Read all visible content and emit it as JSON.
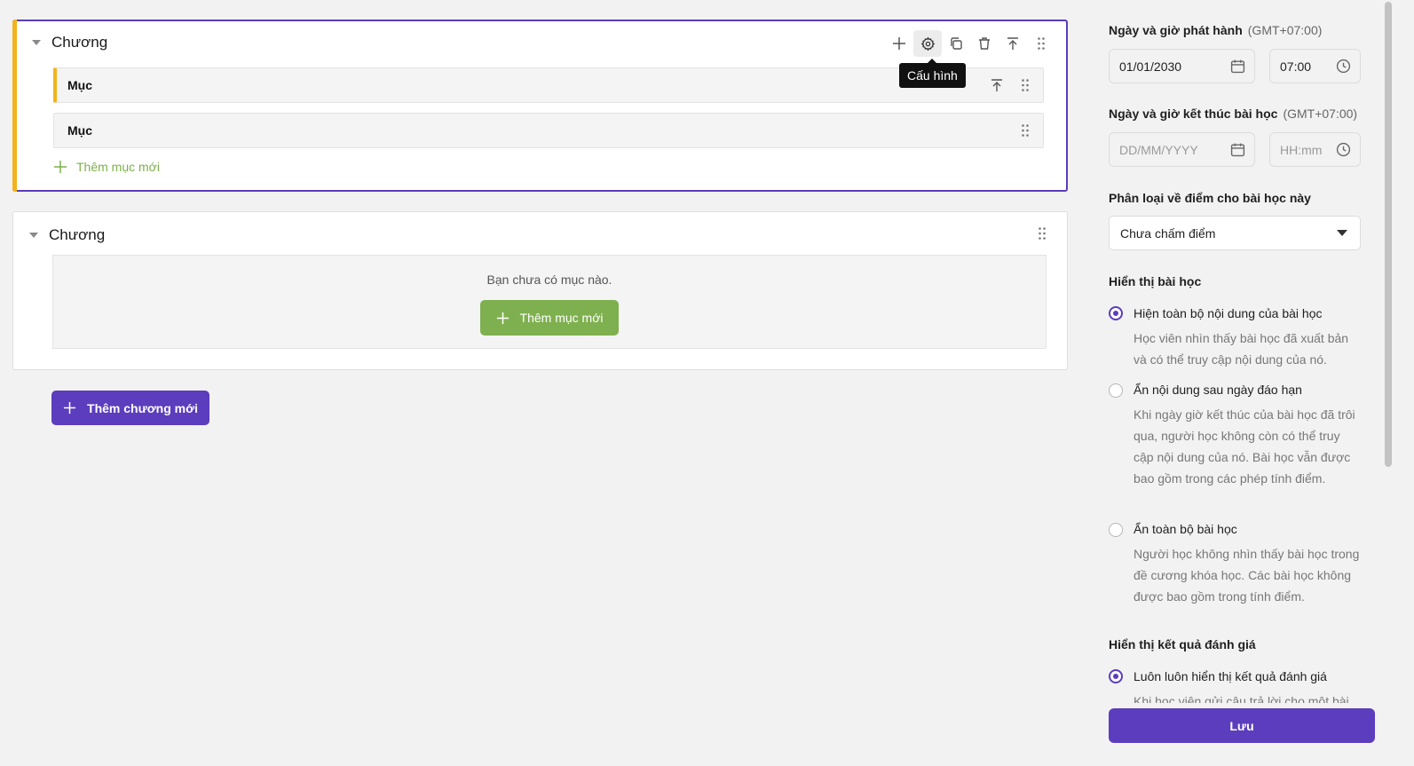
{
  "chapters": [
    {
      "title": "Chương",
      "items": [
        {
          "label": "Mục"
        },
        {
          "label": "Mục"
        }
      ],
      "add_item_label": "Thêm mục mới",
      "tooltip": "Cấu hình"
    },
    {
      "title": "Chương",
      "empty_text": "Bạn chưa có mục nào.",
      "add_item_button": "Thêm mục mới"
    }
  ],
  "add_chapter_label": "Thêm chương mới",
  "panel": {
    "release": {
      "label": "Ngày và giờ phát hành",
      "timezone": "(GMT+07:00)",
      "date": "01/01/2030",
      "time": "07:00"
    },
    "end": {
      "label": "Ngày và giờ kết thúc bài học",
      "timezone": "(GMT+07:00)",
      "date_placeholder": "DD/MM/YYYY",
      "time_placeholder": "HH:mm"
    },
    "grading": {
      "label": "Phân loại về điểm cho bài học này",
      "value": "Chưa chấm điểm"
    },
    "visibility": {
      "label": "Hiển thị bài học",
      "options": [
        {
          "title": "Hiện toàn bộ nội dung của bài học",
          "desc": "Học viên nhìn thấy bài học đã xuất bản và có thể truy cập nội dung của nó.",
          "selected": true
        },
        {
          "title": "Ẩn nội dung sau ngày đáo hạn",
          "desc": "Khi ngày giờ kết thúc của bài học đã trôi qua, người học không còn có thể truy cập nội dung của nó. Bài học vẫn được bao gồm trong các phép tính điểm.",
          "selected": false
        },
        {
          "title": "Ẩn toàn bộ bài học",
          "desc": "Người học không nhìn thấy bài học trong đề cương khóa học. Các bài học không được bao gồm trong tính điểm.",
          "selected": false
        }
      ]
    },
    "results": {
      "label": "Hiển thị kết quả đánh giá",
      "options": [
        {
          "title": "Luôn luôn hiển thị kết quả đánh giá",
          "desc": "Khi học viên gửi câu trả lời cho một bài",
          "selected": true
        }
      ]
    },
    "save_label": "Lưu"
  },
  "colors": {
    "primary": "#5b3dbd",
    "accent": "#f3b41b",
    "green": "#7fb04f"
  }
}
